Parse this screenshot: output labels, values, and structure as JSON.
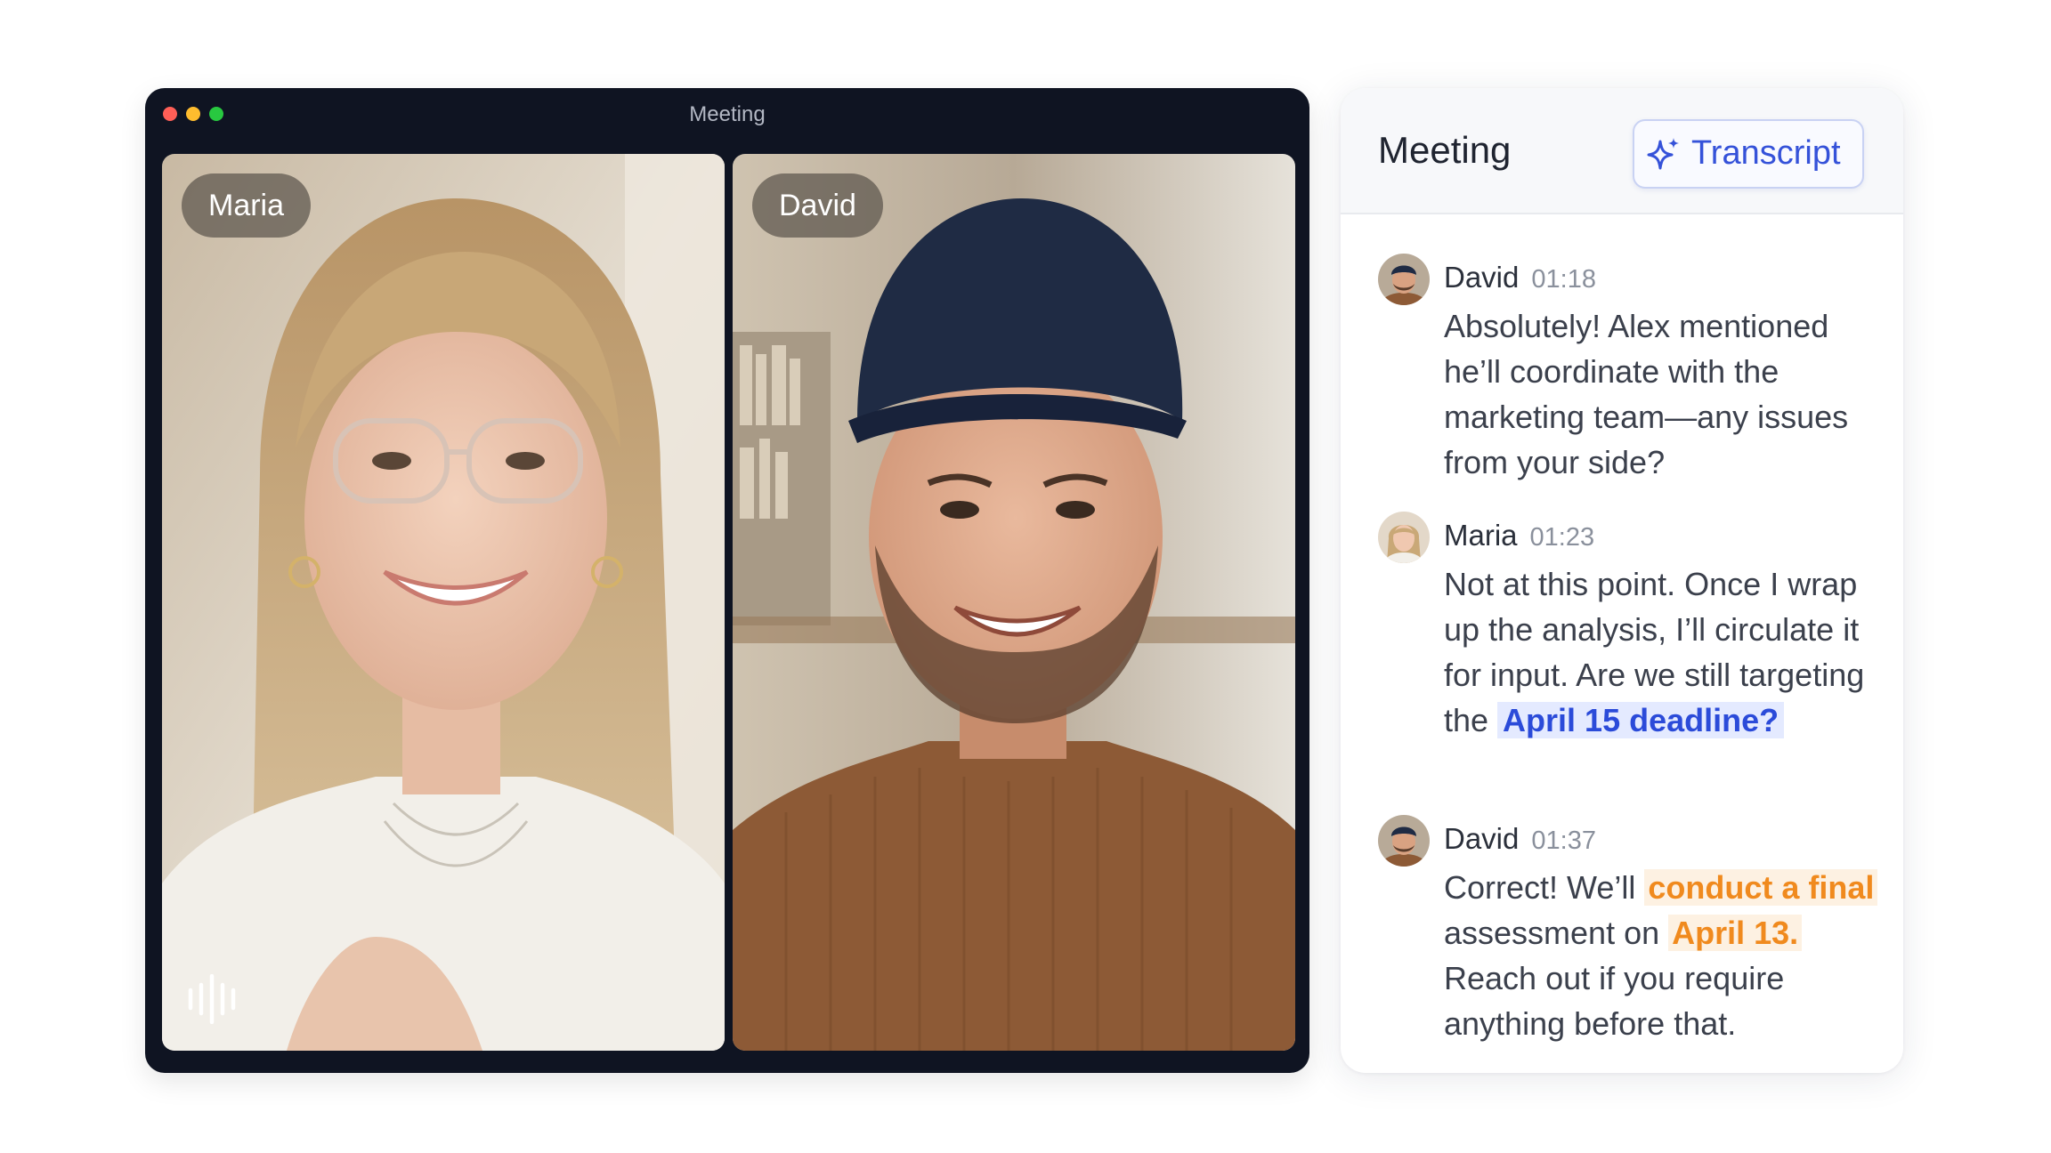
{
  "window": {
    "title": "Meeting"
  },
  "participants": [
    {
      "name": "Maria"
    },
    {
      "name": "David"
    }
  ],
  "panel": {
    "title": "Meeting",
    "transcript_button": "Transcript",
    "messages": [
      {
        "speaker": "David",
        "time": "01:18",
        "text": "Absolutely! Alex mentioned he’ll coordinate with the marketing team—any issues from your side?"
      },
      {
        "speaker": "Maria",
        "time": "01:23",
        "text_before": "Not at this point. Once I wrap up the analysis, I’ll circulate it for input. Are we still targeting the ",
        "highlight": "April 15 deadline?"
      },
      {
        "speaker": "David",
        "time": "01:37",
        "text_1": "Correct! We’ll ",
        "highlight_1": "conduct a final",
        "text_2": " assessment on ",
        "highlight_2": "April 13.",
        "text_3": " Reach out if you require anything before that."
      }
    ]
  },
  "icons": {
    "sparkle": "sparkle-icon",
    "audio": "audio-waveform-icon"
  },
  "colors": {
    "accent_blue": "#2b4bd9",
    "accent_orange": "#f08a1e",
    "window_bg": "#0f1422"
  }
}
